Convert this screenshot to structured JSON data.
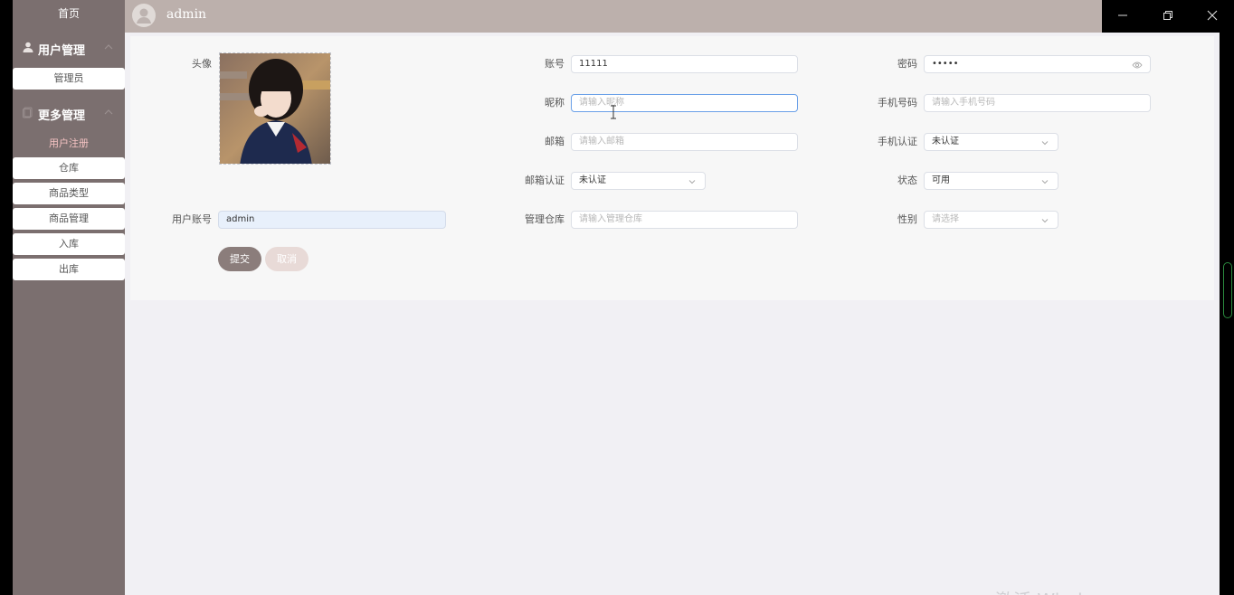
{
  "sidebar": {
    "home": "首页",
    "groups": [
      {
        "label": "用户管理",
        "icon": "user-icon"
      },
      {
        "label": "更多管理",
        "icon": "document-icon"
      }
    ],
    "items": [
      "管理员",
      "用户注册",
      "仓库",
      "商品类型",
      "商品管理",
      "入库",
      "出库"
    ]
  },
  "topbar": {
    "username": "admin"
  },
  "form": {
    "avatar_label": "头像",
    "user_account_label": "用户账号",
    "user_account_value": "admin",
    "account_label": "账号",
    "account_value": "11111",
    "nickname_label": "昵称",
    "nickname_placeholder": "请输入昵称",
    "email_label": "邮箱",
    "email_placeholder": "请输入邮箱",
    "email_verify_label": "邮箱认证",
    "email_verify_value": "未认证",
    "warehouse_label": "管理仓库",
    "warehouse_placeholder": "请输入管理仓库",
    "password_label": "密码",
    "password_value": "•••••",
    "phone_label": "手机号码",
    "phone_placeholder": "请输入手机号码",
    "phone_verify_label": "手机认证",
    "phone_verify_value": "未认证",
    "status_label": "状态",
    "status_value": "可用",
    "gender_label": "性别",
    "gender_placeholder": "请选择",
    "submit": "提交",
    "cancel": "取消"
  },
  "watermark": "激活 Windows",
  "colors": {
    "sidebar": "#7b6f6f",
    "topbar": "#bcb0ac",
    "active_item": "#f4c3c3",
    "submit": "#8b7d7b",
    "cancel": "#e8dad7",
    "focus": "#6aa0e8"
  }
}
